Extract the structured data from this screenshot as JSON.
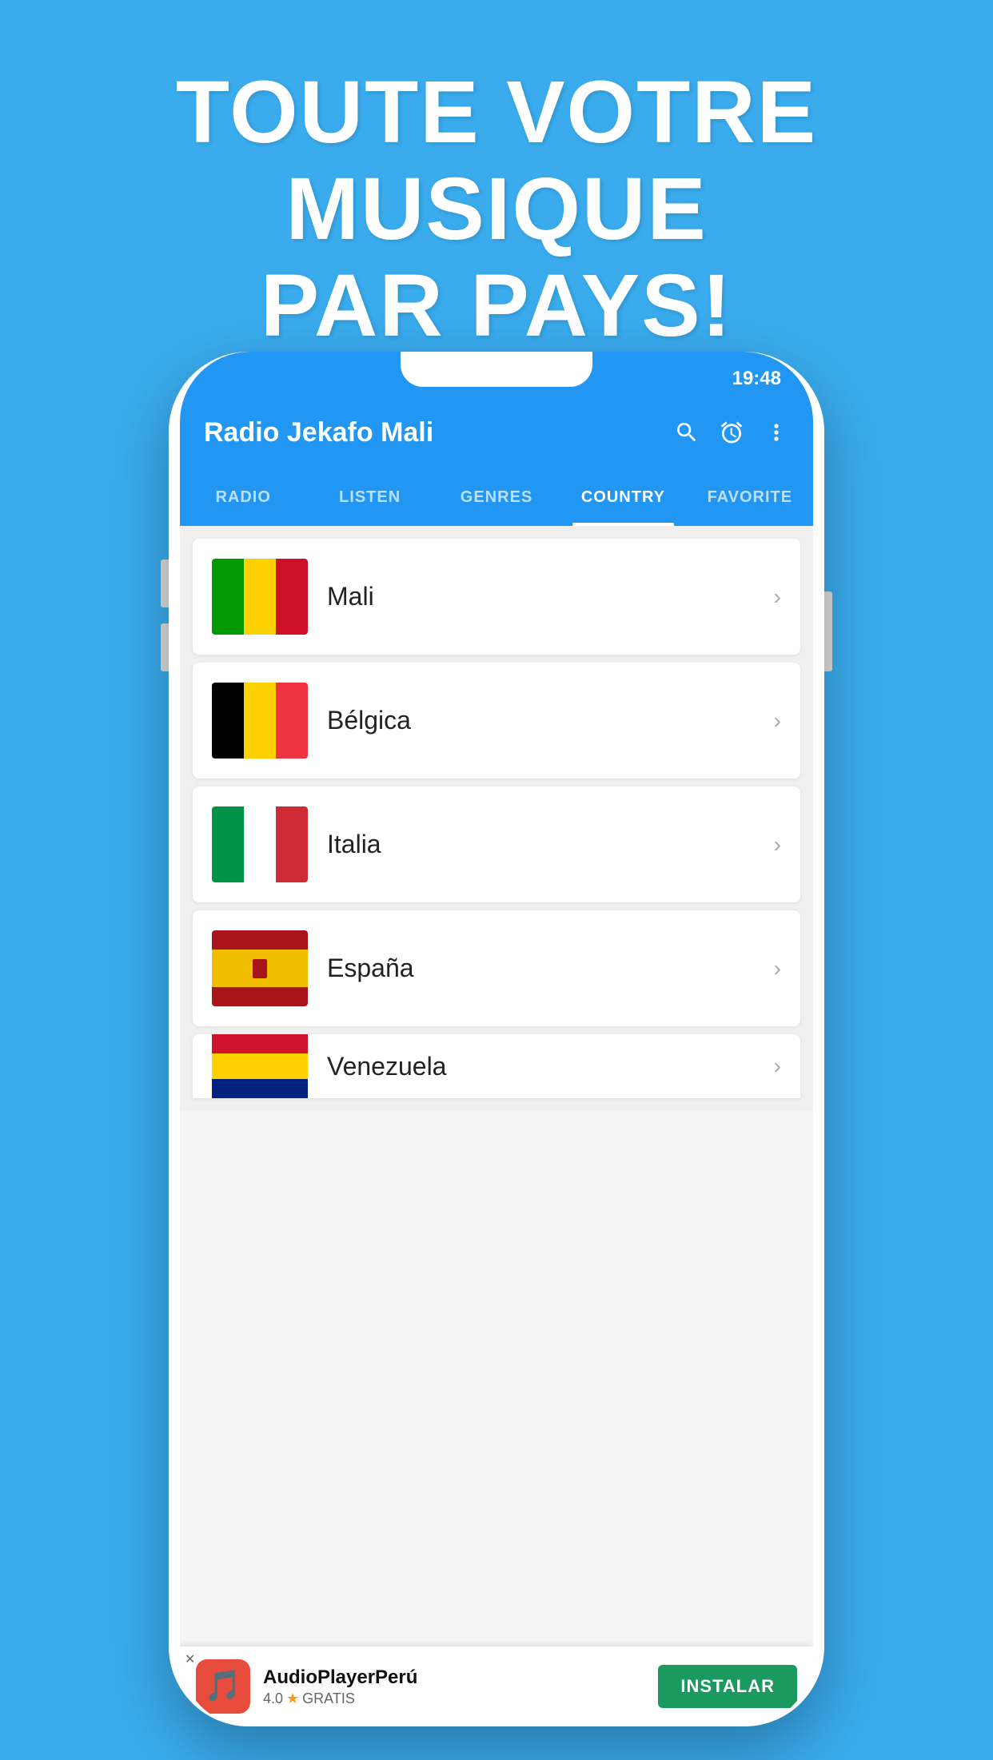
{
  "hero": {
    "line1": "TOUTE VOTRE MUSIQUE",
    "line2": "PAR PAYS!"
  },
  "phone": {
    "status_bar": {
      "time": "19:48"
    },
    "app_bar": {
      "title": "Radio Jekafo Mali",
      "search_icon": "search",
      "alarm_icon": "alarm",
      "more_icon": "more_vert"
    },
    "tabs": [
      {
        "label": "RADIO",
        "active": false
      },
      {
        "label": "LISTEN",
        "active": false
      },
      {
        "label": "GENRES",
        "active": false
      },
      {
        "label": "COUNTRY",
        "active": true
      },
      {
        "label": "FAVORITE",
        "active": false
      }
    ],
    "countries": [
      {
        "name": "Mali",
        "flag_type": "mali"
      },
      {
        "name": "Bélgica",
        "flag_type": "belgium"
      },
      {
        "name": "Italia",
        "flag_type": "italy"
      },
      {
        "name": "España",
        "flag_type": "spain"
      },
      {
        "name": "Venezuela",
        "flag_type": "venezuela",
        "partial": true
      }
    ]
  },
  "ad_banner": {
    "app_name": "AudioPlayerPerú",
    "rating": "4.0",
    "rating_label": "★",
    "free_label": "GRATIS",
    "install_label": "INSTALAR",
    "close_label": "✕"
  }
}
